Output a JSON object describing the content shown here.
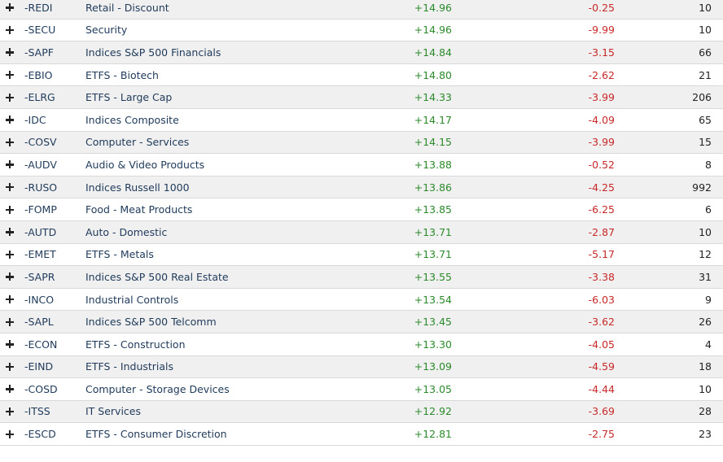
{
  "colors": {
    "positive": "#2b8a2b",
    "negative": "#c82828",
    "text": "#1f3a5a",
    "row_alt": "#f0f0f0"
  },
  "rows": [
    {
      "symbol": "-REDI",
      "name": "Retail - Discount",
      "change_pos": "+14.96",
      "change_neg": "-0.25",
      "count": "10"
    },
    {
      "symbol": "-SECU",
      "name": "Security",
      "change_pos": "+14.96",
      "change_neg": "-9.99",
      "count": "10"
    },
    {
      "symbol": "-SAPF",
      "name": "Indices S&P 500 Financials",
      "change_pos": "+14.84",
      "change_neg": "-3.15",
      "count": "66"
    },
    {
      "symbol": "-EBIO",
      "name": "ETFS - Biotech",
      "change_pos": "+14.80",
      "change_neg": "-2.62",
      "count": "21"
    },
    {
      "symbol": "-ELRG",
      "name": "ETFS - Large Cap",
      "change_pos": "+14.33",
      "change_neg": "-3.99",
      "count": "206"
    },
    {
      "symbol": "-IDC",
      "name": "Indices Composite",
      "change_pos": "+14.17",
      "change_neg": "-4.09",
      "count": "65"
    },
    {
      "symbol": "-COSV",
      "name": "Computer - Services",
      "change_pos": "+14.15",
      "change_neg": "-3.99",
      "count": "15"
    },
    {
      "symbol": "-AUDV",
      "name": "Audio & Video Products",
      "change_pos": "+13.88",
      "change_neg": "-0.52",
      "count": "8"
    },
    {
      "symbol": "-RUSO",
      "name": "Indices Russell 1000",
      "change_pos": "+13.86",
      "change_neg": "-4.25",
      "count": "992"
    },
    {
      "symbol": "-FOMP",
      "name": "Food - Meat Products",
      "change_pos": "+13.85",
      "change_neg": "-6.25",
      "count": "6"
    },
    {
      "symbol": "-AUTD",
      "name": "Auto - Domestic",
      "change_pos": "+13.71",
      "change_neg": "-2.87",
      "count": "10"
    },
    {
      "symbol": "-EMET",
      "name": "ETFS - Metals",
      "change_pos": "+13.71",
      "change_neg": "-5.17",
      "count": "12"
    },
    {
      "symbol": "-SAPR",
      "name": "Indices S&P 500 Real Estate",
      "change_pos": "+13.55",
      "change_neg": "-3.38",
      "count": "31"
    },
    {
      "symbol": "-INCO",
      "name": "Industrial Controls",
      "change_pos": "+13.54",
      "change_neg": "-6.03",
      "count": "9"
    },
    {
      "symbol": "-SAPL",
      "name": "Indices S&P 500 Telcomm",
      "change_pos": "+13.45",
      "change_neg": "-3.62",
      "count": "26"
    },
    {
      "symbol": "-ECON",
      "name": "ETFS - Construction",
      "change_pos": "+13.30",
      "change_neg": "-4.05",
      "count": "4"
    },
    {
      "symbol": "-EIND",
      "name": "ETFS - Industrials",
      "change_pos": "+13.09",
      "change_neg": "-4.59",
      "count": "18"
    },
    {
      "symbol": "-COSD",
      "name": "Computer - Storage Devices",
      "change_pos": "+13.05",
      "change_neg": "-4.44",
      "count": "10"
    },
    {
      "symbol": "-ITSS",
      "name": "IT Services",
      "change_pos": "+12.92",
      "change_neg": "-3.69",
      "count": "28"
    },
    {
      "symbol": "-ESCD",
      "name": "ETFS - Consumer Discretion",
      "change_pos": "+12.81",
      "change_neg": "-2.75",
      "count": "23"
    }
  ]
}
